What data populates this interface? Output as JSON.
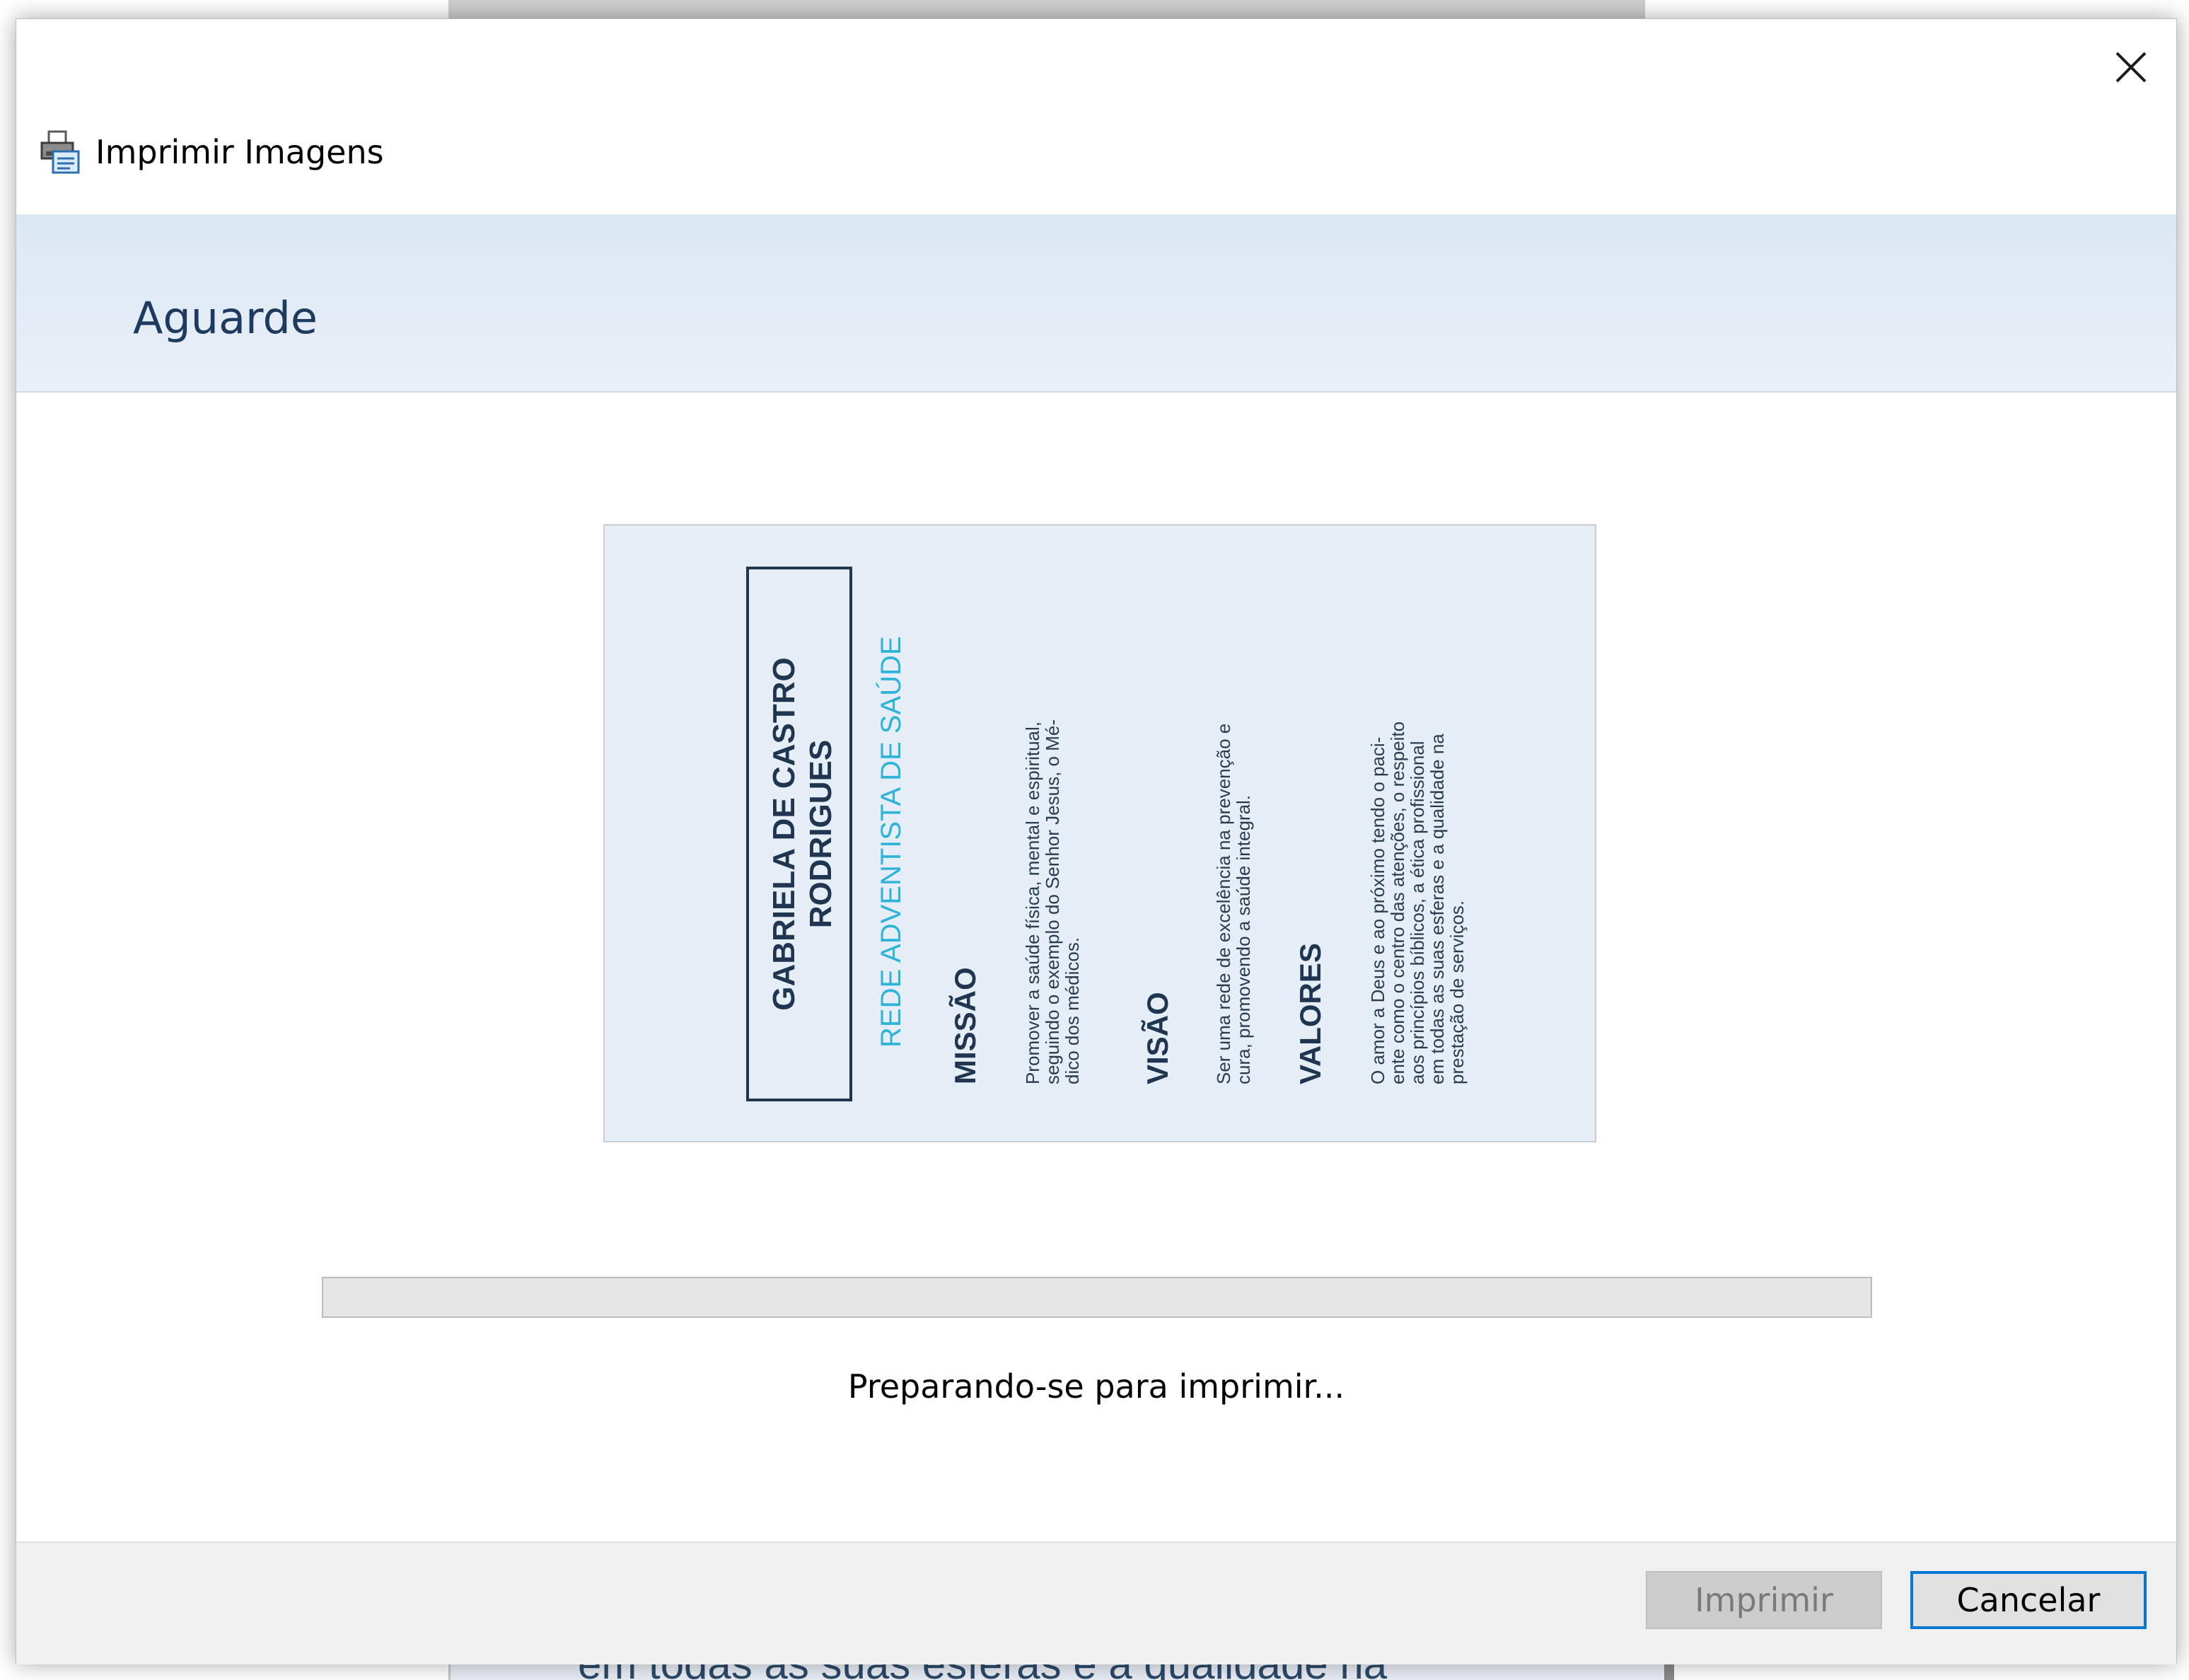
{
  "background": {
    "partial_text": "em todas as suas esferas e a qualidade na"
  },
  "dialog": {
    "title": "Imprimir Imagens",
    "header": "Aguarde",
    "close_icon": "close-icon",
    "title_icon": "printer-icon",
    "status_text": "Preparando-se para imprimir...",
    "progress_percent": 0,
    "buttons": {
      "print": "Imprimir",
      "cancel": "Cancelar"
    }
  },
  "preview_card": {
    "name": "GABRIELA DE CASTRO RODRIGUES",
    "name_line1": "GABRIELA DE CASTRO",
    "name_line2": "RODRIGUES",
    "org": "REDE ADVENTISTA DE SAÚDE",
    "sections": [
      {
        "heading": "MISSÃO",
        "lines": [
          "Promover a saúde física, mental e espiritual,",
          "seguindo o exemplo do Senhor Jesus, o Mé-",
          "dico dos médicos."
        ]
      },
      {
        "heading": "VISÃO",
        "lines": [
          "Ser uma rede de excelência na prevenção e",
          "cura, promovendo a saúde integral."
        ]
      },
      {
        "heading": "VALORES",
        "lines": [
          "O amor a Deus e ao próximo tendo o paci-",
          "ente como o centro das atenções, o respeito",
          "aos princípios bíblicos, a ética profissional",
          "em todas as suas esferas e a qualidade na",
          "prestação de serviços."
        ]
      }
    ],
    "colors": {
      "background": "#e5edf7",
      "name": "#1f3550",
      "org": "#2eb3d8",
      "body": "#2a3b4e"
    }
  },
  "colors": {
    "header_band": "#dbe7f3",
    "accent": "#0078d7",
    "header_text": "#1e3a5f"
  }
}
